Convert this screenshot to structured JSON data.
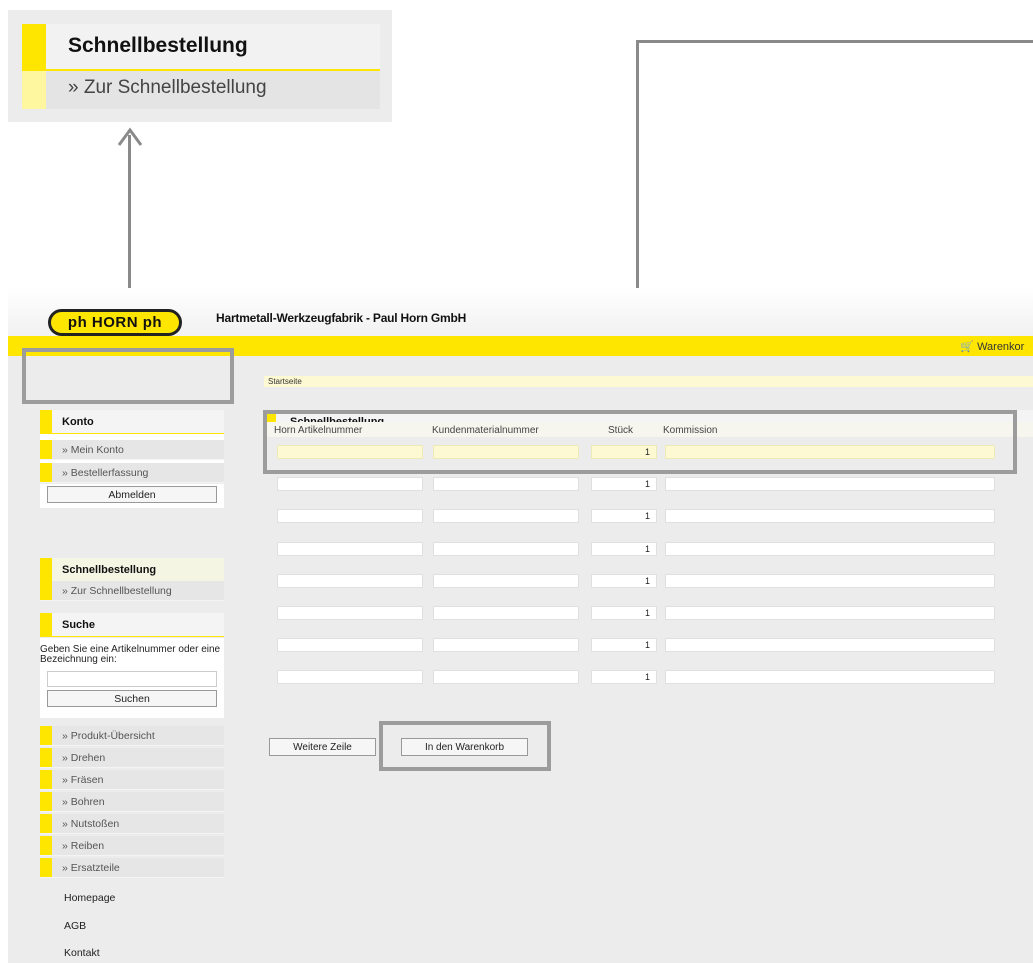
{
  "zoom_callout": {
    "title": "Schnellbestellung",
    "link": "» Zur Schnellbestellung"
  },
  "header": {
    "logo_text": "ph HORN ph",
    "company": "Hartmetall-Werkzeugfabrik - Paul Horn GmbH",
    "cart_label": "Warenkor"
  },
  "breadcrumb": "Startseite",
  "sidebar": {
    "konto": {
      "title": "Konto",
      "items": [
        "» Mein Konto",
        "» Bestellerfassung"
      ],
      "logout_button": "Abmelden"
    },
    "schnellbestellung": {
      "title": "Schnellbestellung",
      "link": "» Zur Schnellbestellung"
    },
    "suche": {
      "title": "Suche",
      "hint": "Geben Sie eine Artikelnummer oder eine Bezeichnung ein:",
      "search_value": "",
      "button": "Suchen"
    },
    "nav_items": [
      "» Produkt-Übersicht",
      "» Drehen",
      "» Fräsen",
      "» Bohren",
      "» Nutstoßen",
      "» Reiben",
      "» Ersatzteile"
    ],
    "links": [
      "Homepage",
      "AGB",
      "Kontakt"
    ]
  },
  "content": {
    "title": "Schnellbestellung",
    "columns": [
      "Horn Artikelnummer",
      "Kundenmaterialnummer",
      "Stück",
      "Kommission"
    ],
    "rows": [
      {
        "artikel": "",
        "kunden": "",
        "stueck": "1",
        "kommission": ""
      },
      {
        "artikel": "",
        "kunden": "",
        "stueck": "1",
        "kommission": ""
      },
      {
        "artikel": "",
        "kunden": "",
        "stueck": "1",
        "kommission": ""
      },
      {
        "artikel": "",
        "kunden": "",
        "stueck": "1",
        "kommission": ""
      },
      {
        "artikel": "",
        "kunden": "",
        "stueck": "1",
        "kommission": ""
      },
      {
        "artikel": "",
        "kunden": "",
        "stueck": "1",
        "kommission": ""
      },
      {
        "artikel": "",
        "kunden": "",
        "stueck": "1",
        "kommission": ""
      },
      {
        "artikel": "",
        "kunden": "",
        "stueck": "1",
        "kommission": ""
      }
    ],
    "more_rows_button": "Weitere Zeile",
    "add_to_cart_button": "In den Warenkorb"
  },
  "icons": {
    "cart": "shopping-cart-icon",
    "arrow": "arrow-up-icon"
  }
}
